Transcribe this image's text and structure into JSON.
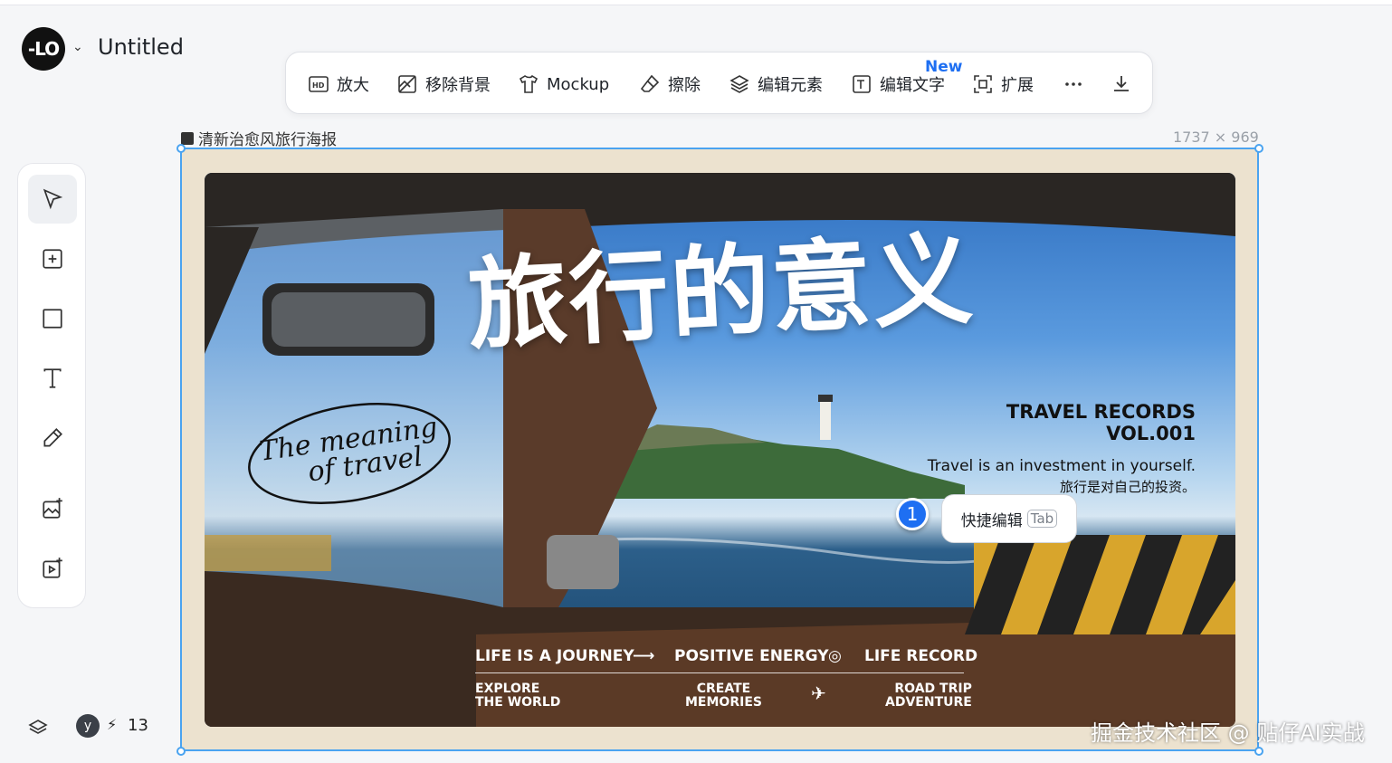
{
  "app": {
    "title": "Untitled",
    "logo_text": "-LO"
  },
  "toolbar": {
    "new_badge": "New",
    "items": [
      {
        "label": "放大",
        "icon": "hd-icon"
      },
      {
        "label": "移除背景",
        "icon": "remove-background-icon"
      },
      {
        "label": "Mockup",
        "icon": "tshirt-icon"
      },
      {
        "label": "擦除",
        "icon": "eraser-icon"
      },
      {
        "label": "编辑元素",
        "icon": "layers-stack-icon"
      },
      {
        "label": "编辑文字",
        "icon": "text-edit-icon"
      },
      {
        "label": "扩展",
        "icon": "expand-icon"
      }
    ],
    "more_icon": "more-dots-icon",
    "download_icon": "download-icon"
  },
  "rail": [
    "pointer-icon",
    "add-frame-icon",
    "rectangle-icon",
    "text-icon",
    "pen-icon",
    "image-generate-icon",
    "video-generate-icon"
  ],
  "canvas": {
    "image_name": "清新治愈风旅行海报",
    "dimensions": "1737 × 969"
  },
  "poster": {
    "title": "旅行的意义",
    "script_line1": "The meaning",
    "script_line2": "of travel",
    "records_line1": "TRAVEL RECORDS",
    "records_line2": "VOL.001",
    "tagline_en": "Travel is an investment in yourself.",
    "tagline_cn": "旅行是对自己的投资。",
    "ribbon_1": "LIFE IS A JOURNEY",
    "ribbon_arrow": "⟶",
    "ribbon_2": "POSITIVE ENERGY",
    "ribbon_3": "LIFE RECORD",
    "sub_1a": "EXPLORE",
    "sub_1b": "THE WORLD",
    "sub_2a": "CREATE",
    "sub_2b": "MEMORIES",
    "sub_3a": "ROAD TRIP",
    "sub_3b": "ADVENTURE"
  },
  "quick_edit": {
    "pin_number": "1",
    "label": "快捷编辑",
    "key": "Tab"
  },
  "footer": {
    "avatar_letter": "y",
    "bolt": "⚡",
    "credits": "13"
  },
  "watermark": "掘金技术社区 @ 贴仔AI实战",
  "colors": {
    "accent": "#1e6ff2",
    "selection": "#4aa3f0"
  }
}
